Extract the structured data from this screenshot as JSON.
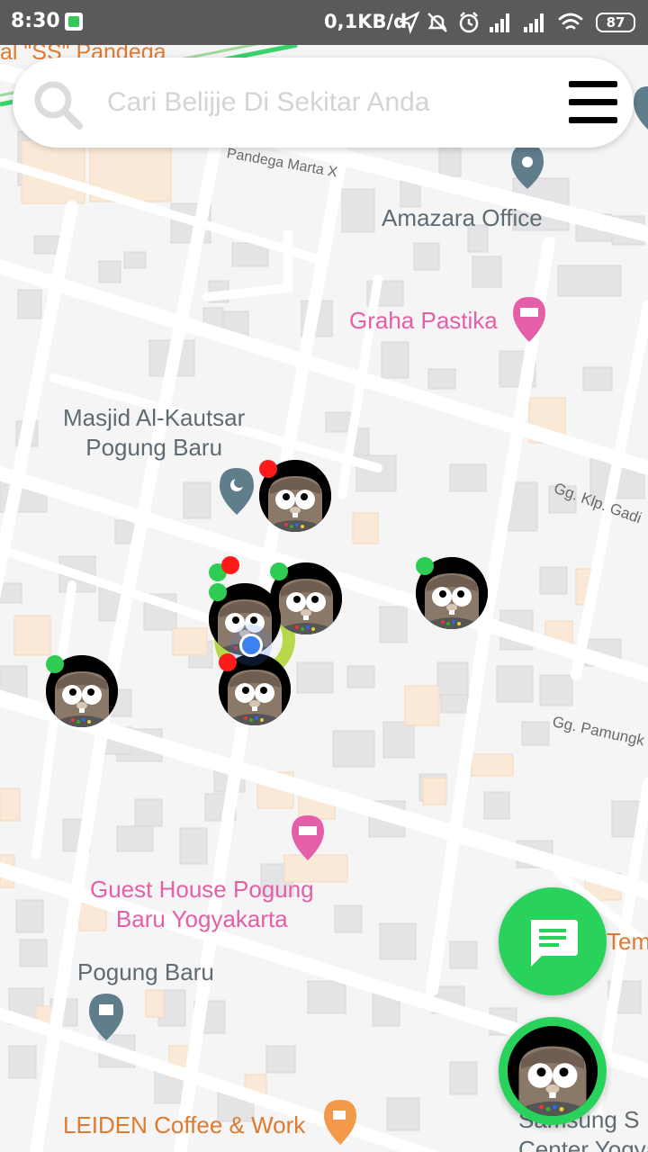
{
  "status_bar": {
    "time": "8:30",
    "net_speed": "0,1KB/d",
    "battery": "87",
    "icons": [
      "app-notification-icon",
      "location-arrow-icon",
      "bell-off-icon",
      "alarm-icon",
      "signal-icon",
      "signal-icon",
      "wifi-icon",
      "battery-icon"
    ]
  },
  "search": {
    "placeholder": "Cari Belijje Di Sekitar Anda",
    "value": "",
    "icon": "search-icon",
    "menu_icon": "hamburger-menu-icon"
  },
  "map": {
    "places": {
      "top_edge": "al \"SS\" Pandega",
      "amazara": "Amazara Office",
      "graha_line1": "Graha Pastika",
      "masjid_line1": "Masjid Al-Kautsar",
      "masjid_line2": "Pogung Baru",
      "guesthouse_line1": "Guest House Pogung",
      "guesthouse_line2": "Baru Yogyakarta",
      "pogung": "Pogung Baru",
      "leiden": "LEIDEN Coffee & Work",
      "tem": "Tem",
      "samsung_line1": "Samsung S",
      "samsung_line2": "Center Yogya"
    },
    "roads": {
      "pandega_marta": "Pandega Marta X",
      "klp_gading": "Gg. Klp. Gadi",
      "pamungkas": "Gg. Pamungk"
    },
    "colors": {
      "background": "#f5f5f6",
      "road": "#ffffff",
      "building": "#e4e4e6",
      "poi_pink": "#e55ea8",
      "poi_gray": "#607d8b",
      "poi_orange": "#f29a4a",
      "online": "#2ecc52",
      "offline": "#ff1a1a",
      "my_location": "#3b82f0"
    }
  },
  "sellers": [
    {
      "id": "seller-1",
      "status": "offline"
    },
    {
      "id": "seller-2",
      "status": "offline"
    },
    {
      "id": "seller-3",
      "status": "online"
    },
    {
      "id": "seller-4",
      "status": "online"
    },
    {
      "id": "seller-5",
      "status": "online"
    },
    {
      "id": "seller-6",
      "status": "online"
    },
    {
      "id": "seller-7",
      "status": "offline"
    }
  ],
  "fabs": {
    "chat_icon": "chat-icon",
    "profile_icon": "profile-avatar-icon"
  }
}
